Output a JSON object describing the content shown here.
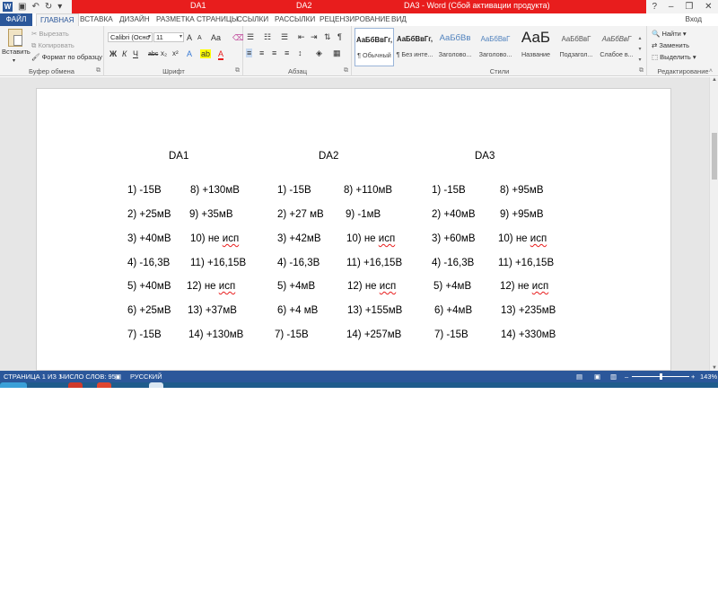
{
  "titlebar": {
    "tab1": "DA1",
    "tab2": "DA2",
    "title": "DA3 - Word (Сбой активации продукта)",
    "help": "?",
    "minimize": "–",
    "restore": "❐",
    "close": "✕"
  },
  "tabs": {
    "file": "ФАЙЛ",
    "items": [
      "ГЛАВНАЯ",
      "ВСТАВКА",
      "ДИЗАЙН",
      "РАЗМЕТКА СТРАНИЦЫ",
      "ССЫЛКИ",
      "РАССЫЛКИ",
      "РЕЦЕНЗИРОВАНИЕ",
      "ВИД"
    ],
    "signin": "Вход"
  },
  "ribbon": {
    "clipboard": {
      "paste": "Вставить",
      "cut": "Вырезать",
      "copy": "Копировать",
      "format_painter": "Формат по образцу",
      "label": "Буфер обмена"
    },
    "font": {
      "font_name": "Calibri (Осно",
      "font_size": "11",
      "grow": "A",
      "shrink": "A",
      "case": "Aa",
      "bold": "Ж",
      "italic": "К",
      "underline": "Ч",
      "strike": "abc",
      "subscript": "x₂",
      "superscript": "x²",
      "label": "Шрифт"
    },
    "paragraph": {
      "label": "Абзац",
      "pilcrow": "¶"
    },
    "styles": {
      "label": "Стили",
      "items": [
        {
          "sample": "АаБбВвГг,",
          "name": "¶ Обычный"
        },
        {
          "sample": "АаБбВвГг,",
          "name": "¶ Без инте..."
        },
        {
          "sample": "АаБбВв",
          "name": "Заголово..."
        },
        {
          "sample": "АаБбВвГ",
          "name": "Заголово..."
        },
        {
          "sample": "АаБ",
          "name": "Название"
        },
        {
          "sample": "АаБбВвГ",
          "name": "Подзагол..."
        },
        {
          "sample": "АаБбВвГ",
          "name": "Слабое в..."
        }
      ]
    },
    "editing": {
      "find": "Найти",
      "replace": "Заменить",
      "select": "Выделить",
      "label": "Редактирование"
    }
  },
  "document": {
    "headers": [
      "DA1",
      "DA2",
      "DA3"
    ],
    "da1": {
      "col1": [
        "1) -15В",
        "2) +25мВ",
        "3) +40мВ",
        "4) -16,3В",
        "5) +40мВ",
        "6) +25мВ",
        "7) -15В"
      ],
      "col2": [
        "8) +130мВ",
        "9) +35мВ",
        "10) не исп",
        "11) +16,15В",
        "12) не исп",
        "13) +37мВ",
        "14) +130мВ"
      ]
    },
    "da2": {
      "col1": [
        "1) -15В",
        "2) +27 мВ",
        "3) +42мВ",
        "4) -16,3В",
        "5) +4мВ",
        "6) +4 мВ",
        "7) -15В"
      ],
      "col2": [
        "8) +110мВ",
        "9) -1мВ",
        "10) не исп",
        "11) +16,15В",
        "12) не исп",
        "13) +155мВ",
        "14) +257мВ"
      ]
    },
    "da3": {
      "col1": [
        "1) -15В",
        "2) +40мВ",
        "3) +60мВ",
        "4) -16,3В",
        "5) +4мВ",
        "6) +4мВ",
        "7) -15В"
      ],
      "col2": [
        "8) +95мВ",
        "9) +95мВ",
        "10) не исп",
        "11) +16,15В",
        "12) не исп",
        "13) +235мВ",
        "14) +330мВ"
      ]
    }
  },
  "status": {
    "page": "СТРАНИЦА 1 ИЗ 1",
    "words": "ЧИСЛО СЛОВ: 95",
    "language": "РУССКИЙ",
    "zoom": "143%",
    "minus": "–",
    "plus": "+"
  },
  "colors": {
    "accent": "#2b579a",
    "title_bar": "#e81d1d",
    "spell_error": "#e81d1d"
  }
}
